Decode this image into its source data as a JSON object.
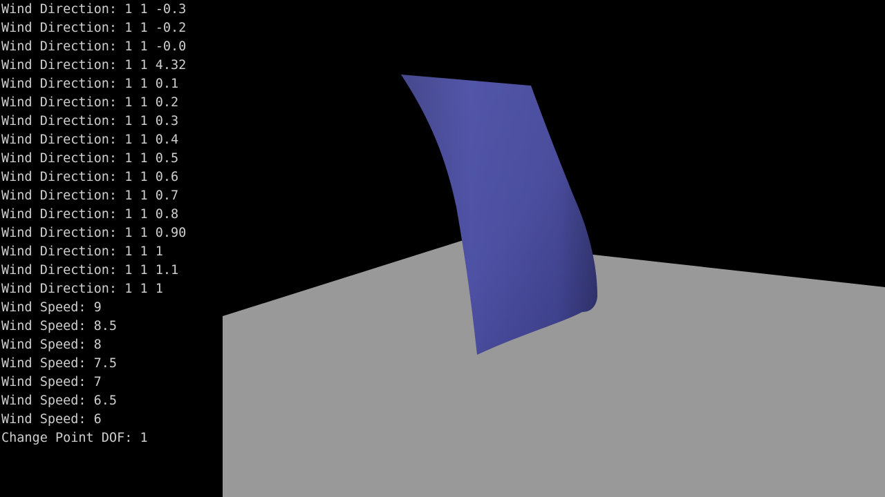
{
  "console": {
    "lines": [
      "Wind Direction: 1 1 -0.3",
      "Wind Direction: 1 1 -0.2",
      "Wind Direction: 1 1 -0.0",
      "Wind Direction: 1 1 4.32",
      "Wind Direction: 1 1 0.1",
      "Wind Direction: 1 1 0.2",
      "Wind Direction: 1 1 0.3",
      "Wind Direction: 1 1 0.4",
      "Wind Direction: 1 1 0.5",
      "Wind Direction: 1 1 0.6",
      "Wind Direction: 1 1 0.7",
      "Wind Direction: 1 1 0.8",
      "Wind Direction: 1 1 0.90",
      "Wind Direction: 1 1 1",
      "Wind Direction: 1 1 1.1",
      "Wind Direction: 1 1 1",
      "Wind Speed: 9",
      "Wind Speed: 8.5",
      "Wind Speed: 8",
      "Wind Speed: 7.5",
      "Wind Speed: 7",
      "Wind Speed: 6.5",
      "Wind Speed: 6",
      "Change Point DOF: 1"
    ]
  },
  "scene": {
    "background_color": "#000000",
    "floor_color": "#999999",
    "cloth_color": "#4f52a6"
  }
}
